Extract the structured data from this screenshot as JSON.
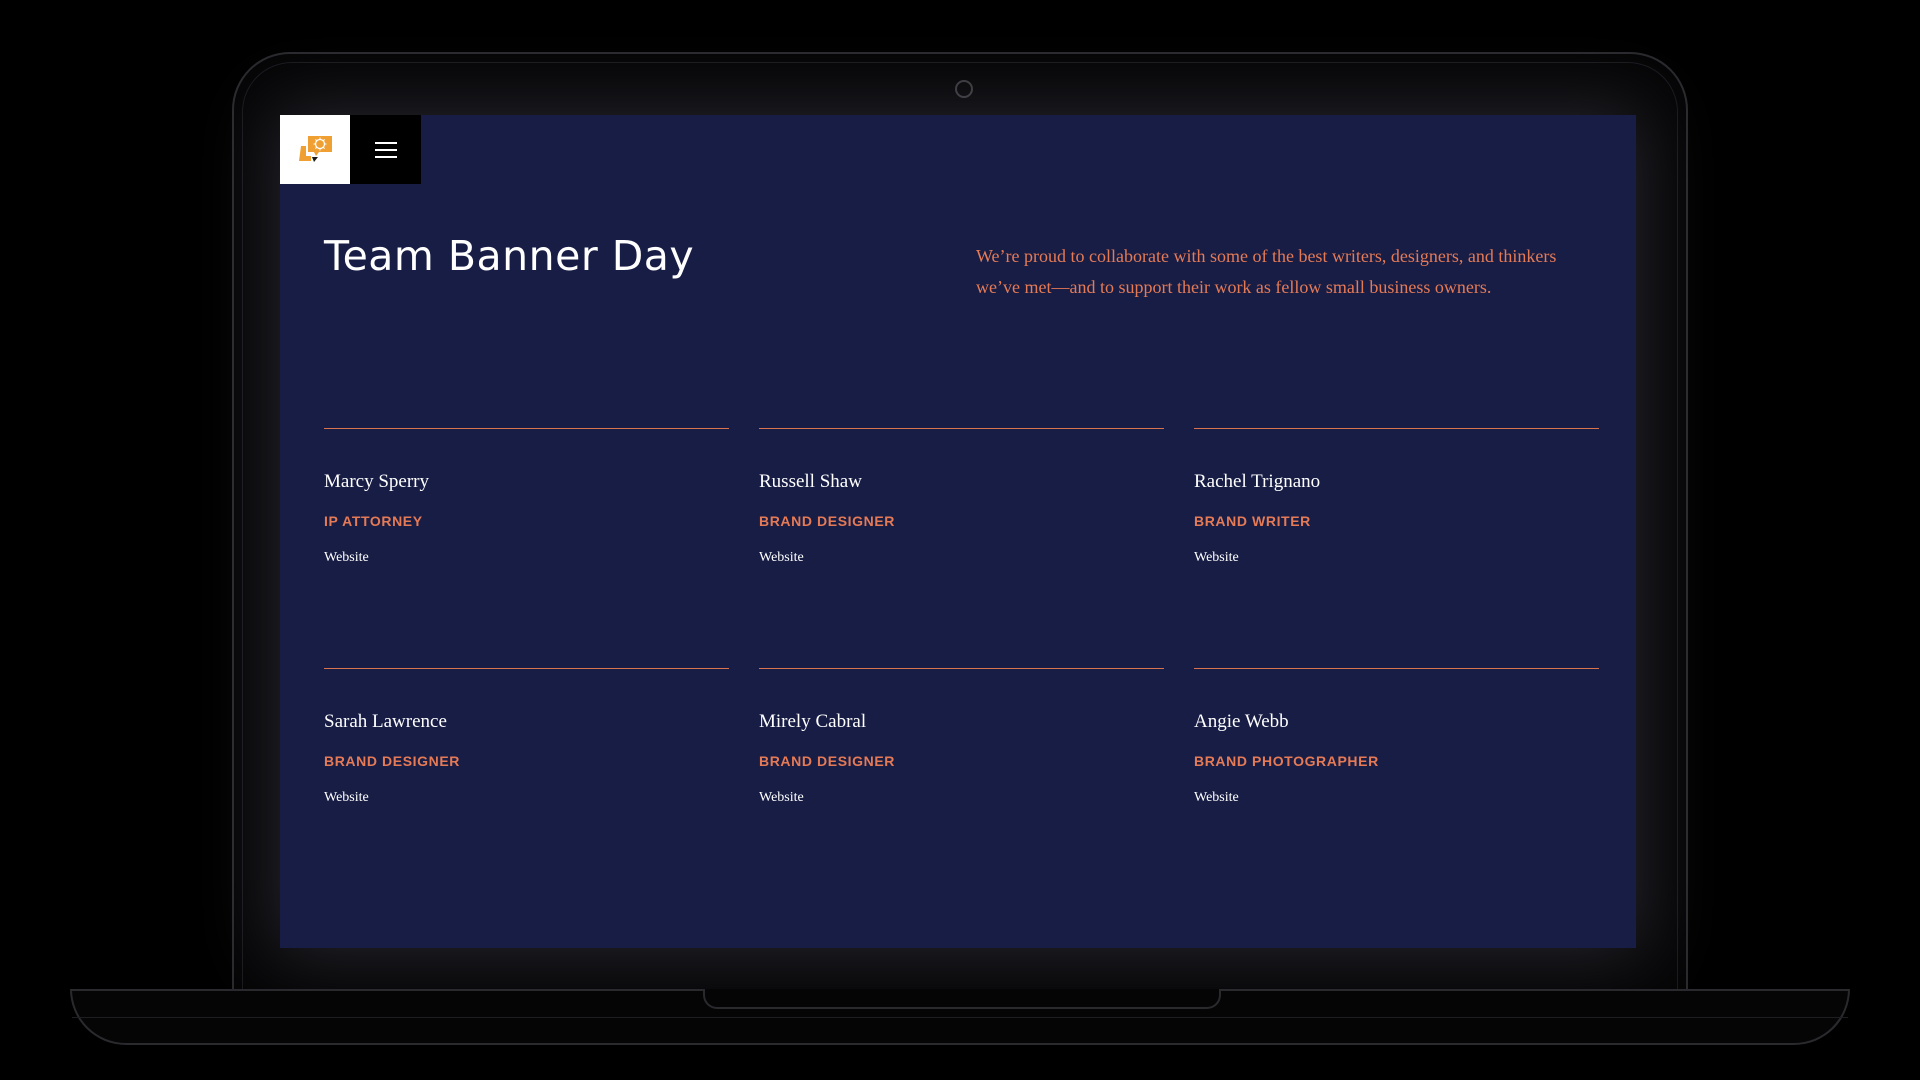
{
  "page": {
    "title": "Team Banner Day",
    "intro": "We’re proud to collaborate with some of the best writers, designers, and thinkers we’ve met—and to support their work as fellow small business owners."
  },
  "header": {
    "logo_icon": "banner-day-logo-icon",
    "menu_icon": "hamburger-menu-icon"
  },
  "team": [
    {
      "name": "Marcy Sperry",
      "role": "IP ATTORNEY",
      "link": "Website"
    },
    {
      "name": "Russell Shaw",
      "role": "BRAND DESIGNER",
      "link": "Website"
    },
    {
      "name": "Rachel Trignano",
      "role": "BRAND WRITER",
      "link": "Website"
    },
    {
      "name": "Sarah Lawrence",
      "role": "BRAND DESIGNER",
      "link": "Website"
    },
    {
      "name": "Mirely Cabral",
      "role": "BRAND DESIGNER",
      "link": "Website"
    },
    {
      "name": "Angie Webb",
      "role": "BRAND PHOTOGRAPHER",
      "link": "Website"
    }
  ],
  "colors": {
    "background": "#181d45",
    "accent": "#e57a56",
    "logo_orange": "#f0a032",
    "text": "#ffffff"
  }
}
